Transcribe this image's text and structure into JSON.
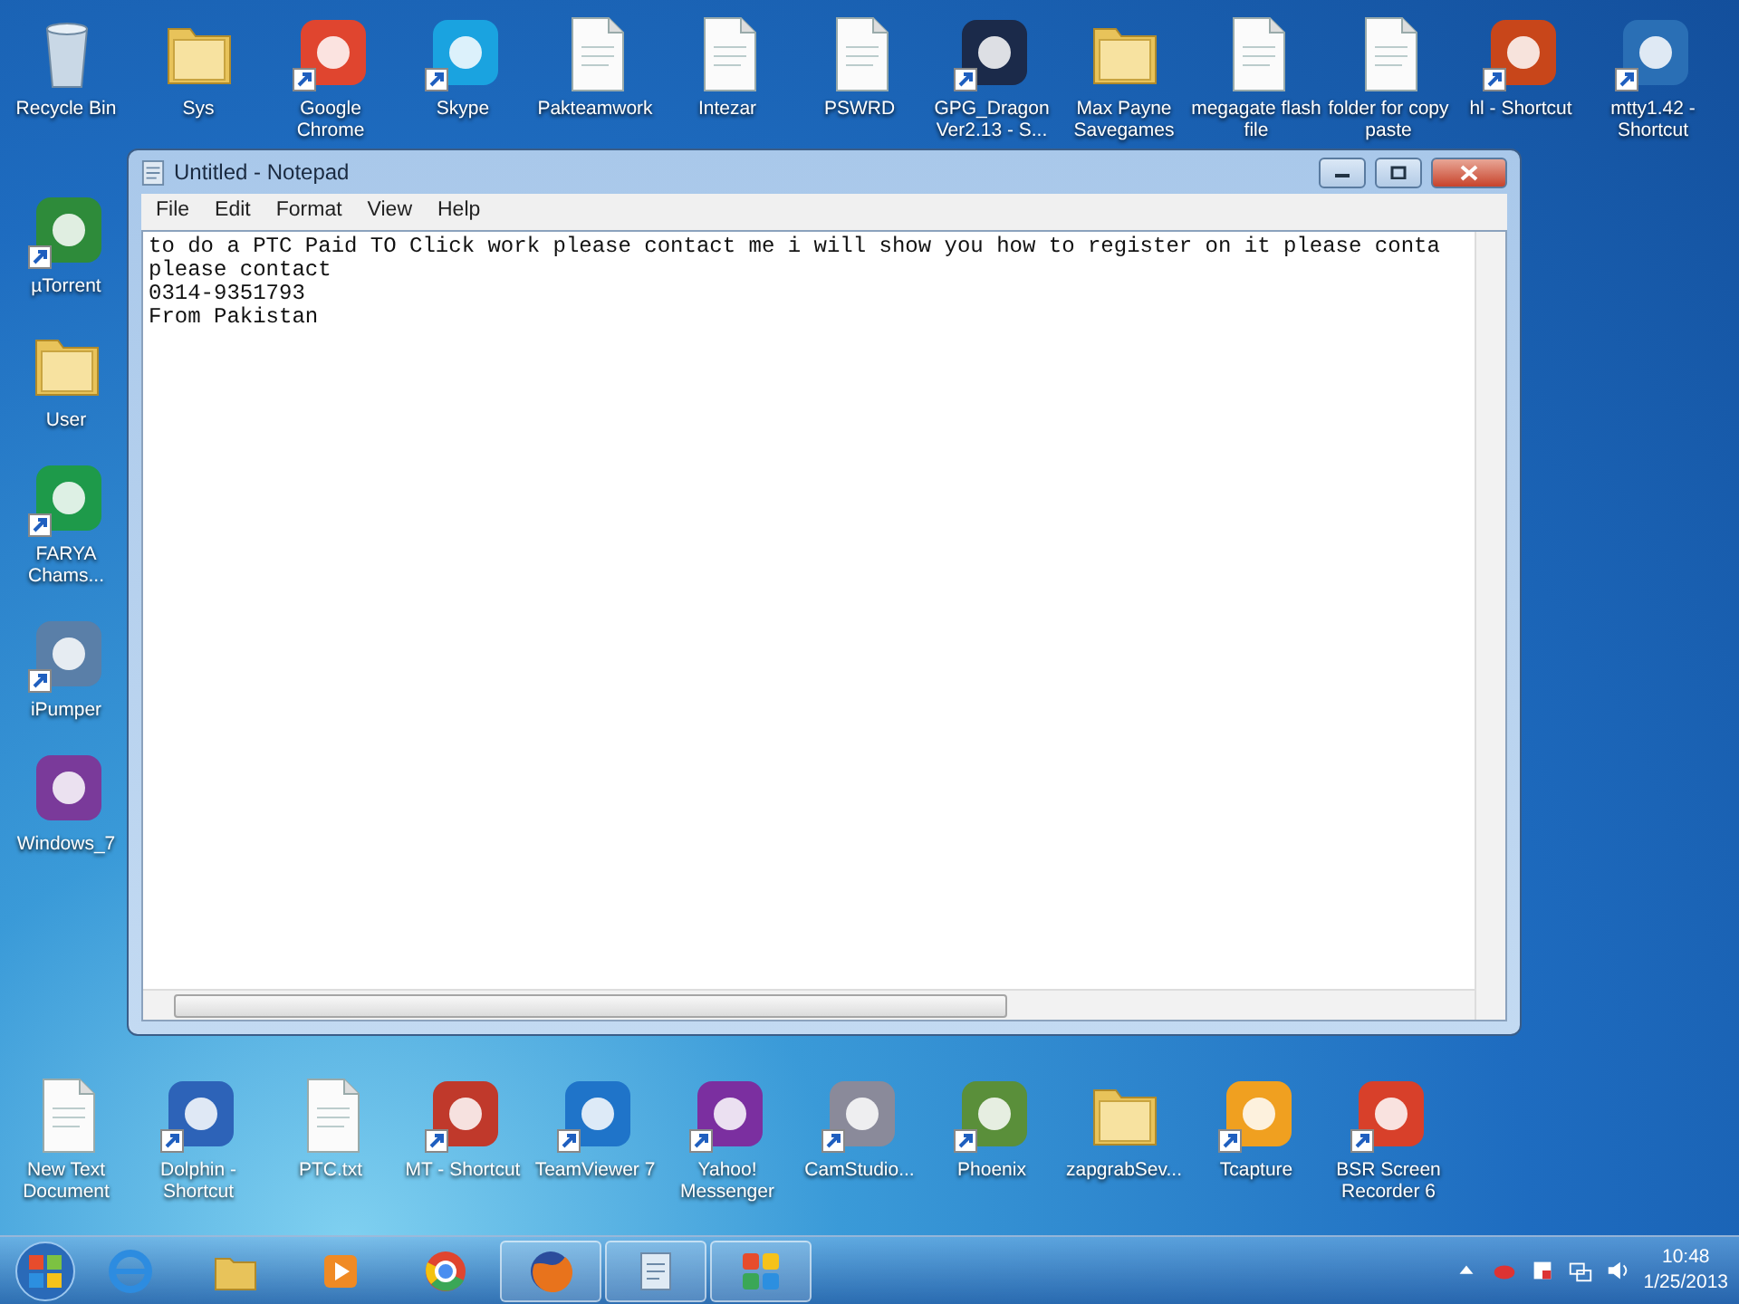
{
  "desktop": {
    "top_icons": [
      {
        "label": "Recycle Bin",
        "kind": "bin",
        "shortcut": false
      },
      {
        "label": "Sys",
        "kind": "folder",
        "shortcut": false
      },
      {
        "label": "Google Chrome",
        "kind": "app",
        "color": "#e0452f",
        "shortcut": true
      },
      {
        "label": "Skype",
        "kind": "app",
        "color": "#1aa3e0",
        "shortcut": true
      },
      {
        "label": "Pakteamwork",
        "kind": "document",
        "shortcut": false
      },
      {
        "label": "Intezar",
        "kind": "document",
        "shortcut": false
      },
      {
        "label": "PSWRD",
        "kind": "document",
        "shortcut": false
      },
      {
        "label": "GPG_Dragon Ver2.13 - S...",
        "kind": "app",
        "color": "#1b2a4a",
        "shortcut": true
      },
      {
        "label": "Max Payne Savegames",
        "kind": "folder",
        "shortcut": false
      },
      {
        "label": "megagate flash file",
        "kind": "document",
        "shortcut": false
      },
      {
        "label": "folder for copy paste",
        "kind": "document",
        "shortcut": false
      },
      {
        "label": "hl - Shortcut",
        "kind": "app",
        "color": "#c8461a",
        "shortcut": true
      },
      {
        "label": "mtty1.42 - Shortcut",
        "kind": "app",
        "color": "#2a6fb5",
        "shortcut": true
      }
    ],
    "left_icons": [
      {
        "label": "µTorrent",
        "kind": "app",
        "color": "#2e8b3a",
        "shortcut": true
      },
      {
        "label": "User",
        "kind": "folder",
        "shortcut": false
      },
      {
        "label": "FARYA Chams...",
        "kind": "app",
        "color": "#1e9a4a",
        "shortcut": true
      },
      {
        "label": "iPumper",
        "kind": "app",
        "color": "#5a7fa8",
        "shortcut": true
      },
      {
        "label": "Windows_7",
        "kind": "app",
        "color": "#7a3a9a",
        "shortcut": false
      }
    ],
    "bottom_icons": [
      {
        "label": "New Text Document",
        "kind": "document",
        "shortcut": false
      },
      {
        "label": "Dolphin - Shortcut",
        "kind": "app",
        "color": "#2d63b8",
        "shortcut": true
      },
      {
        "label": "PTC.txt",
        "kind": "document",
        "shortcut": false
      },
      {
        "label": "MT - Shortcut",
        "kind": "app",
        "color": "#c0392b",
        "shortcut": true
      },
      {
        "label": "TeamViewer 7",
        "kind": "app",
        "color": "#1f74c9",
        "shortcut": true
      },
      {
        "label": "Yahoo! Messenger",
        "kind": "app",
        "color": "#7b2fa0",
        "shortcut": true
      },
      {
        "label": "CamStudio...",
        "kind": "app",
        "color": "#8a8a9a",
        "shortcut": true
      },
      {
        "label": "Phoenix",
        "kind": "app",
        "color": "#5a8f3a",
        "shortcut": true
      },
      {
        "label": "zapgrabSev...",
        "kind": "folder",
        "shortcut": false
      },
      {
        "label": "Tcapture",
        "kind": "app",
        "color": "#f0a020",
        "shortcut": true
      },
      {
        "label": "BSR Screen Recorder 6",
        "kind": "app",
        "color": "#d8402a",
        "shortcut": true
      }
    ]
  },
  "notepad": {
    "title": "Untitled - Notepad",
    "menu": [
      "File",
      "Edit",
      "Format",
      "View",
      "Help"
    ],
    "lines": [
      "to do a PTC Paid TO Click work please contact me i will show you how to register on it please conta",
      "please contact",
      "0314-9351793",
      "From Pakistan"
    ]
  },
  "taskbar": {
    "items": [
      {
        "kind": "browser",
        "running": false
      },
      {
        "kind": "folder",
        "running": false
      },
      {
        "kind": "media",
        "running": false
      },
      {
        "kind": "chrome",
        "running": false
      },
      {
        "kind": "firefox",
        "running": true
      },
      {
        "kind": "notepad",
        "running": true
      },
      {
        "kind": "tiles",
        "running": true
      }
    ],
    "clock": {
      "time": "10:48",
      "date": "1/25/2013"
    }
  }
}
